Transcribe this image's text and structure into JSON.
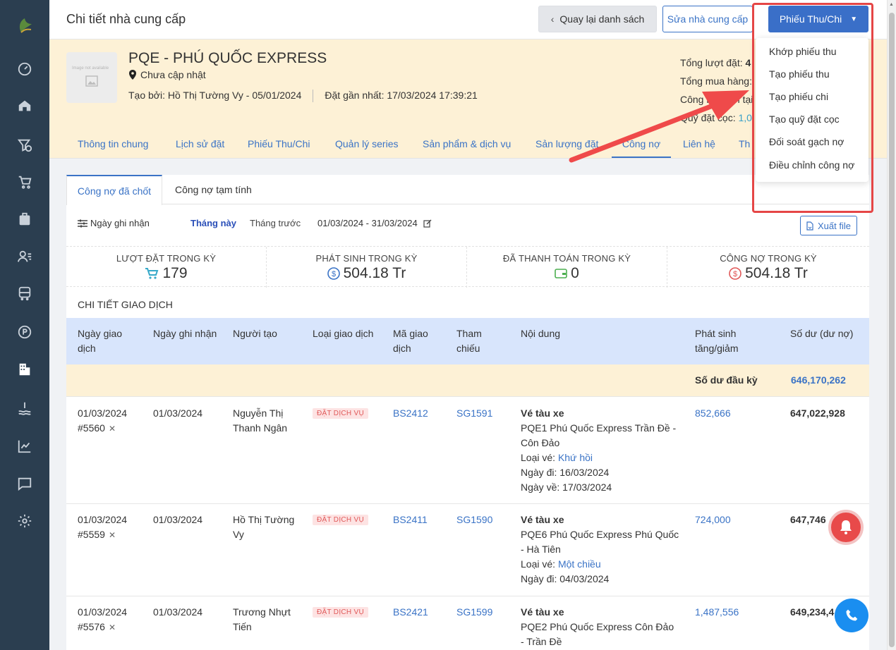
{
  "header": {
    "title": "Chi tiết nhà cung cấp",
    "back_label": "Quay lại danh sách",
    "edit_label": "Sửa nhà cung cấp",
    "receipt_label": "Phiếu Thu/Chi"
  },
  "dropdown": {
    "items": [
      "Khớp phiếu thu",
      "Tạo phiếu thu",
      "Tạo phiếu chi",
      "Tạo quỹ đặt cọc",
      "Đối soát gạch nợ",
      "Điều chỉnh công nợ"
    ]
  },
  "supplier": {
    "image_placeholder": "Image not available",
    "name": "PQE - PHÚ QUỐC EXPRESS",
    "address": "Chưa cập nhật",
    "created": "Tạo bởi: Hồ Thị Tường Vy - 05/01/2024",
    "last_booking": "Đặt gần nhất: 17/03/2024 17:39:21",
    "stat_bookings_label": "Tổng lượt đặt:",
    "stat_bookings_value": "4",
    "stat_purchase_label": "Tổng mua hàng:",
    "stat_debt_label": "Công nợ hiện tại",
    "stat_deposit_label": "Quỹ đặt cọc:",
    "stat_deposit_value": "1,0"
  },
  "tabs": [
    "Thông tin chung",
    "Lịch sử đặt",
    "Phiếu Thu/Chi",
    "Quản lý series",
    "Sản phẩm & dịch vụ",
    "Sản lượng đặt",
    "Công nợ",
    "Liên hệ",
    "Th"
  ],
  "subtabs": [
    "Công nợ đã chốt",
    "Công nợ tạm tính"
  ],
  "filter": {
    "date_label": "Ngày ghi nhận",
    "this_month": "Tháng này",
    "last_month": "Tháng trước",
    "range": "01/03/2024 - 31/03/2024",
    "export_label": "Xuất file"
  },
  "summary": [
    {
      "title": "LƯỢT ĐẶT TRONG KỲ",
      "value": "179",
      "icon": "cart-icon"
    },
    {
      "title": "PHÁT SINH TRONG KỲ",
      "value": "504.18 Tr",
      "icon": "dollar-circle-icon"
    },
    {
      "title": "ĐÃ THANH TOÁN TRONG KỲ",
      "value": "0",
      "icon": "wallet-icon"
    },
    {
      "title": "CÔNG NỢ TRONG KỲ",
      "value": "504.18 Tr",
      "icon": "dollar-circle-icon"
    }
  ],
  "section_title": "CHI TIẾT GIAO DỊCH",
  "table": {
    "headers": [
      "Ngày giao dịch",
      "Ngày ghi nhận",
      "Người tạo",
      "Loại giao dịch",
      "Mã giao dịch",
      "Tham chiếu",
      "Nội dung",
      "Phát sinh tăng/giảm",
      "Số dư (dư nợ)"
    ],
    "opening_label": "Số dư đầu kỳ",
    "opening_value": "646,170,262",
    "rows": [
      {
        "date": "01/03/2024",
        "id": "#5560",
        "recorded": "01/03/2024",
        "creator": "Nguyễn Thị Thanh Ngân",
        "type": "ĐẶT DỊCH VỤ",
        "code": "BS2412",
        "ref": "SG1591",
        "content_title": "Vé tàu xe",
        "content_route": "PQE1 Phú Quốc Express Trần Đề - Côn Đảo",
        "ticket_label": "Loại vé:",
        "ticket_type": "Khứ hồi",
        "depart": "Ngày đi: 16/03/2024",
        "return": "Ngày về: 17/03/2024",
        "amount": "852,666",
        "balance": "647,022,928"
      },
      {
        "date": "01/03/2024",
        "id": "#5559",
        "recorded": "01/03/2024",
        "creator": "Hồ Thị Tường Vy",
        "type": "ĐẶT DỊCH VỤ",
        "code": "BS2411",
        "ref": "SG1590",
        "content_title": "Vé tàu xe",
        "content_route": "PQE6 Phú Quốc Express Phú Quốc - Hà Tiên",
        "ticket_label": "Loại vé:",
        "ticket_type": "Một chiều",
        "depart": "Ngày đi: 04/03/2024",
        "return": "",
        "amount": "724,000",
        "balance": "647,746"
      },
      {
        "date": "01/03/2024",
        "id": "#5576",
        "recorded": "01/03/2024",
        "creator": "Trương Nhựt Tiến",
        "type": "ĐẶT DỊCH VỤ",
        "code": "BS2421",
        "ref": "SG1599",
        "content_title": "Vé tàu xe",
        "content_route": "PQE2 Phú Quốc Express Côn Đảo - Trần Đề",
        "ticket_label": "",
        "ticket_type": "",
        "depart": "",
        "return": "",
        "amount": "1,487,556",
        "balance": "649,234,4"
      }
    ]
  },
  "colors": {
    "accent": "#3a73c6",
    "sidebar": "#2b3e50",
    "highlight_box": "#e54646",
    "header_band": "#fdf1d6"
  }
}
